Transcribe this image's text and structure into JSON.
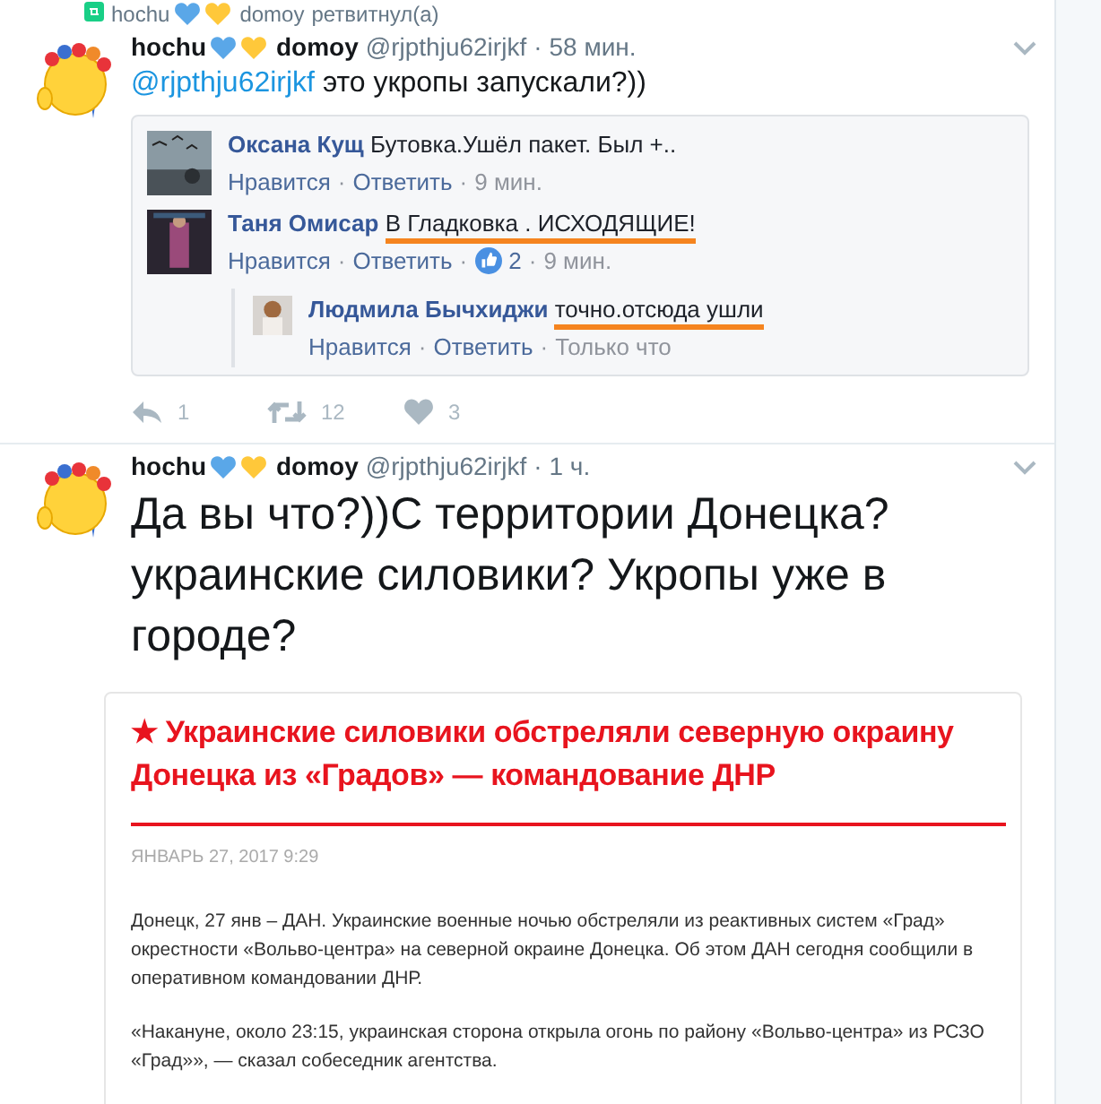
{
  "sep": "·",
  "retweet_line": {
    "name_first": "hochu",
    "name_second": "domoy",
    "action": "ретвитнул(а)"
  },
  "tweets": [
    {
      "kind": "conversation",
      "name_first": "hochu",
      "name_second": "domoy",
      "handle": "@rjpthju62irjkf",
      "time": "58 мин.",
      "mention": "@rjpthju62irjkf",
      "text": "это укропы запускали?))",
      "comments": [
        {
          "author": "Оксана Кущ",
          "text": "Бутовка.Ушёл пакет. Был +..",
          "highlighted": false,
          "like": "Нравится",
          "reply": "Ответить",
          "time": "9 мин."
        },
        {
          "author": "Таня Омисар",
          "text": "В Гладковка . ИСХОДЯЩИЕ!",
          "highlighted": true,
          "like": "Нравится",
          "reply": "Ответить",
          "likes": "2",
          "time": "9 мин.",
          "children": [
            {
              "author": "Людмила Бычхиджи",
              "text": "точно.отсюда ушли",
              "highlighted": true,
              "like": "Нравится",
              "reply": "Ответить",
              "time": "Только что"
            }
          ]
        }
      ],
      "actions": [
        {
          "kind": "reply",
          "count": "1"
        },
        {
          "kind": "retweet",
          "count": "12"
        },
        {
          "kind": "like",
          "count": "3"
        }
      ]
    },
    {
      "kind": "article",
      "name_first": "hochu",
      "name_second": "domoy",
      "handle": "@rjpthju62irjkf",
      "time": "1 ч.",
      "text": "Да вы что?))С территории Донецка? украинские силовики? Укропы уже в городе?",
      "article": {
        "title": "★ Украинские силовики обстреляли северную окраину Донецка из «Градов» — командование ДНР",
        "date": "ЯНВАРЬ 27, 2017 9:29",
        "paragraphs": [
          "Донецк, 27 янв – ДАН. Украинские военные ночью обстреляли из реактивных систем «Град» окрестности «Вольво-центра» на северной окраине Донецка. Об этом ДАН сегодня сообщили в оперативном командовании ДНР.",
          "«Накануне, около 23:15, украинская сторона открыла огонь по району «Вольво-центра» из РСЗО «Град»», — сказал собеседник агентства."
        ]
      }
    }
  ]
}
